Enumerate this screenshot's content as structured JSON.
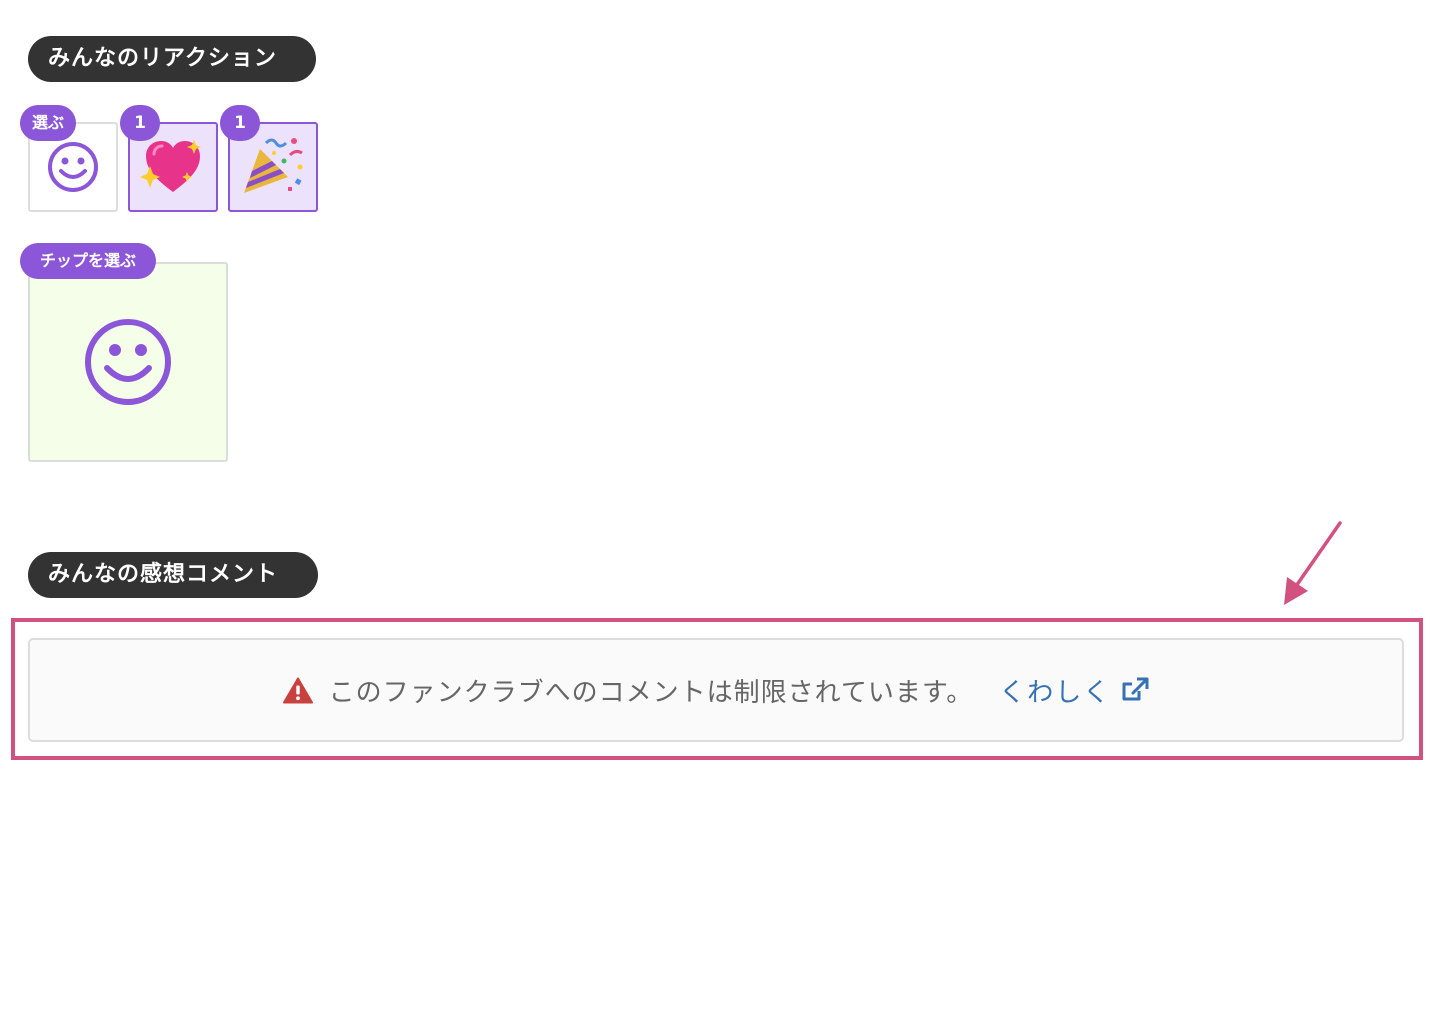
{
  "reactions_section": {
    "title": "みんなのリアクション",
    "select_badge": "選ぶ",
    "items": [
      {
        "emoji": "💖",
        "count": "1"
      },
      {
        "emoji": "🎉",
        "count": "1"
      }
    ]
  },
  "tip_section": {
    "select_badge": "チップを選ぶ"
  },
  "comments_section": {
    "title": "みんなの感想コメント",
    "notice_text": "このファンクラブへのコメントは制限されています。",
    "details_link": "くわしく"
  },
  "colors": {
    "accent_purple": "#8b56d8",
    "highlight_pink": "#d2527f",
    "link_blue": "#3670b5",
    "warning_red": "#c9413e"
  },
  "icons": {
    "reaction_add": "smiley-icon",
    "tip_add": "smiley-icon",
    "notice": "warning-triangle-icon",
    "link": "external-link-icon"
  }
}
